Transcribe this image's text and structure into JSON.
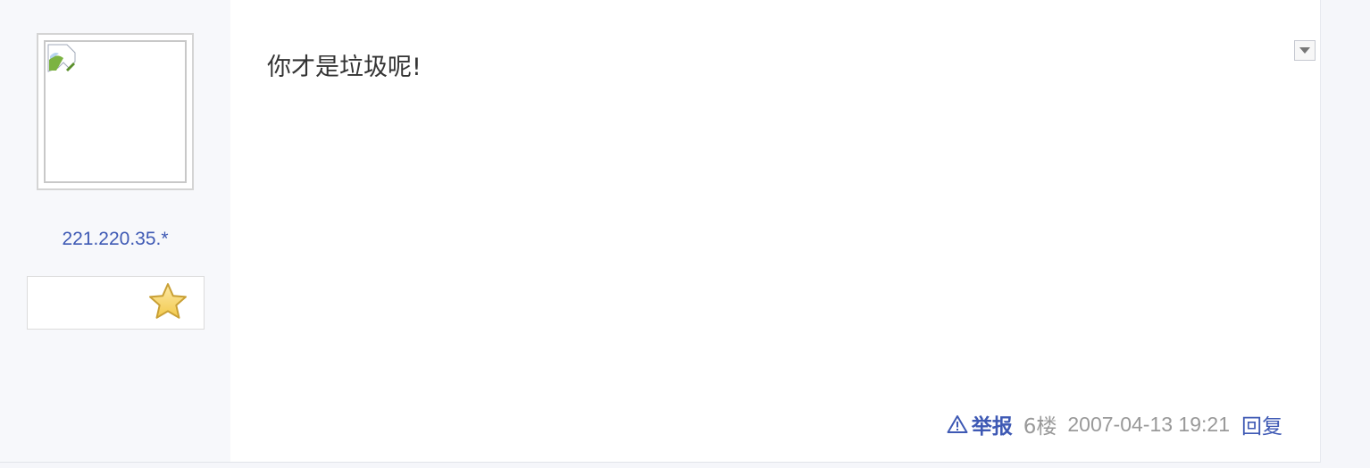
{
  "author": {
    "avatar_icon": "broken-image-icon",
    "name": "221.220.35.*",
    "level_icon": "star-icon"
  },
  "post": {
    "content": "你才是垃圾呢!",
    "menu_icon": "dropdown-arrow-icon"
  },
  "tail": {
    "report_icon": "warning-triangle-icon",
    "report_label": "举报",
    "floor": "6楼",
    "time": "2007-04-13 19:21",
    "reply_label": "回复"
  },
  "colors": {
    "link": "#3e59b4",
    "muted": "#999999",
    "sidebar_bg": "#f7f8fb",
    "page_bg": "#f5f6fa"
  }
}
